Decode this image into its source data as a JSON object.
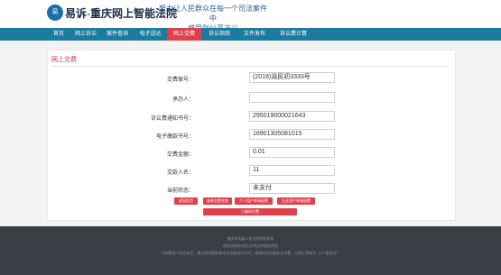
{
  "header": {
    "logo_text": "易",
    "brand": "易诉-重庆网上智能法院",
    "slogan_line1": "努力让人民群众在每一个司法案件中",
    "slogan_line2": "感受到公平正义"
  },
  "nav": {
    "items": [
      {
        "label": "首页"
      },
      {
        "label": "网上诉讼"
      },
      {
        "label": "案件查询"
      },
      {
        "label": "电子送达"
      },
      {
        "label": "网上交费"
      },
      {
        "label": "诉讼指南"
      },
      {
        "label": "文件发布"
      },
      {
        "label": "诉讼费计算"
      }
    ],
    "active": "网上交费"
  },
  "panel": {
    "title": "网上交费"
  },
  "form": {
    "fields": [
      {
        "label": "交费案号：",
        "value": "(2019)渝民初3333号"
      },
      {
        "label": "承办人：",
        "value": ""
      },
      {
        "label": "诉讼费通知书号：",
        "value": "295019000021643"
      },
      {
        "label": "电子缴款书号：",
        "value": "16901305081015"
      },
      {
        "label": "交费金额：",
        "value": "0.01"
      },
      {
        "label": "交款人名：",
        "value": "11"
      },
      {
        "label": "当前状态：",
        "value": "未支付"
      }
    ]
  },
  "buttons": {
    "back": "返回首页",
    "query": "查询交费状态",
    "personal": "个人用户申请退费",
    "enterprise": "企业用户申请退费",
    "qr": "二维码交费"
  },
  "footer": {
    "line1": "重庆市高级人民法院版权所有",
    "line2": "地址及联系电话 技术支持服务热线",
    "line3": "为保障用户信息安全，建议使用最新版本浏览器进行访问，请保持浏览器安全设置，以便正常使用（ICP备案号）"
  },
  "colors": {
    "nav": "#1d7b9f",
    "accent": "#e0404c",
    "footer": "#3c3e45"
  }
}
